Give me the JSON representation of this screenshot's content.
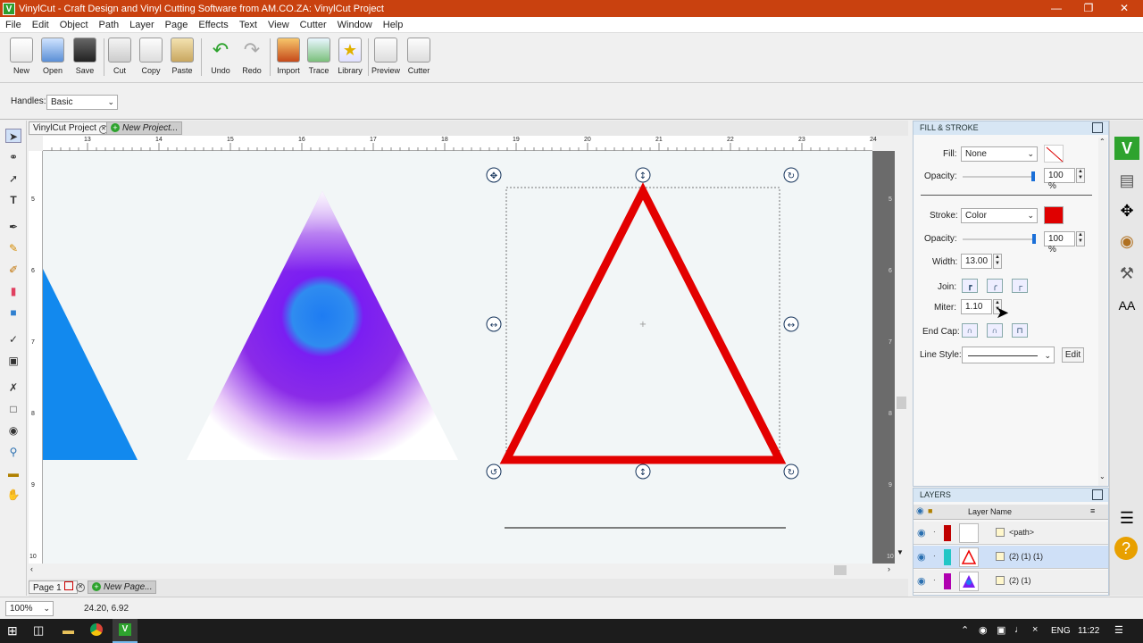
{
  "window": {
    "title": "VinylCut - Craft Design and Vinyl Cutting Software from AM.CO.ZA: VinylCut Project",
    "app_icon": "V"
  },
  "menu": [
    "File",
    "Edit",
    "Object",
    "Path",
    "Layer",
    "Page",
    "Effects",
    "Text",
    "View",
    "Cutter",
    "Window",
    "Help"
  ],
  "toolbar": [
    {
      "label": "New",
      "icon": "new-icon"
    },
    {
      "label": "Open",
      "icon": "open-icon"
    },
    {
      "label": "Save",
      "icon": "save-icon"
    },
    {
      "label": "Cut",
      "icon": "cut-icon"
    },
    {
      "label": "Copy",
      "icon": "copy-icon"
    },
    {
      "label": "Paste",
      "icon": "paste-icon"
    },
    {
      "label": "Undo",
      "icon": "undo-icon"
    },
    {
      "label": "Redo",
      "icon": "redo-icon"
    },
    {
      "label": "Import",
      "icon": "import-icon"
    },
    {
      "label": "Trace",
      "icon": "trace-icon"
    },
    {
      "label": "Library",
      "icon": "library-icon"
    },
    {
      "label": "Preview",
      "icon": "preview-icon"
    },
    {
      "label": "Cutter",
      "icon": "cutter-icon"
    }
  ],
  "handles": {
    "label": "Handles:",
    "value": "Basic"
  },
  "tabs": {
    "doc": "VinylCut Project",
    "new": "New Project..."
  },
  "ruler": {
    "top": [
      "13",
      "14",
      "15",
      "16",
      "17",
      "18",
      "19",
      "20",
      "21",
      "22",
      "23",
      "24"
    ],
    "left": [
      "5",
      "6",
      "7",
      "8",
      "9",
      "10"
    ],
    "right": [
      "5",
      "6",
      "7",
      "8",
      "9",
      "10"
    ]
  },
  "fill_stroke": {
    "title": "FILL & STROKE",
    "fill_label": "Fill:",
    "fill_value": "None",
    "opacity_label": "Opacity:",
    "fill_opacity": "100 %",
    "stroke_label": "Stroke:",
    "stroke_value": "Color",
    "stroke_color": "#e00000",
    "stroke_opacity": "100 %",
    "width_label": "Width:",
    "width_value": "13.00",
    "join_label": "Join:",
    "miter_label": "Miter:",
    "miter_value": "1.10",
    "endcap_label": "End Cap:",
    "linestyle_label": "Line Style:",
    "edit_label": "Edit"
  },
  "layers": {
    "title": "LAYERS",
    "col": "Layer Name",
    "rows": [
      {
        "name": "<path>",
        "color": "#c00000"
      },
      {
        "name": "(2) (1) (1)",
        "color": "#22c6c6"
      },
      {
        "name": "(2) (1)",
        "color": "#b000b0"
      }
    ]
  },
  "pages": {
    "page": "Page 1",
    "new": "New Page..."
  },
  "status": {
    "zoom": "100%",
    "coords": "24.20, 6.92"
  },
  "taskbar": {
    "lang": "ENG",
    "time": "11:22"
  }
}
